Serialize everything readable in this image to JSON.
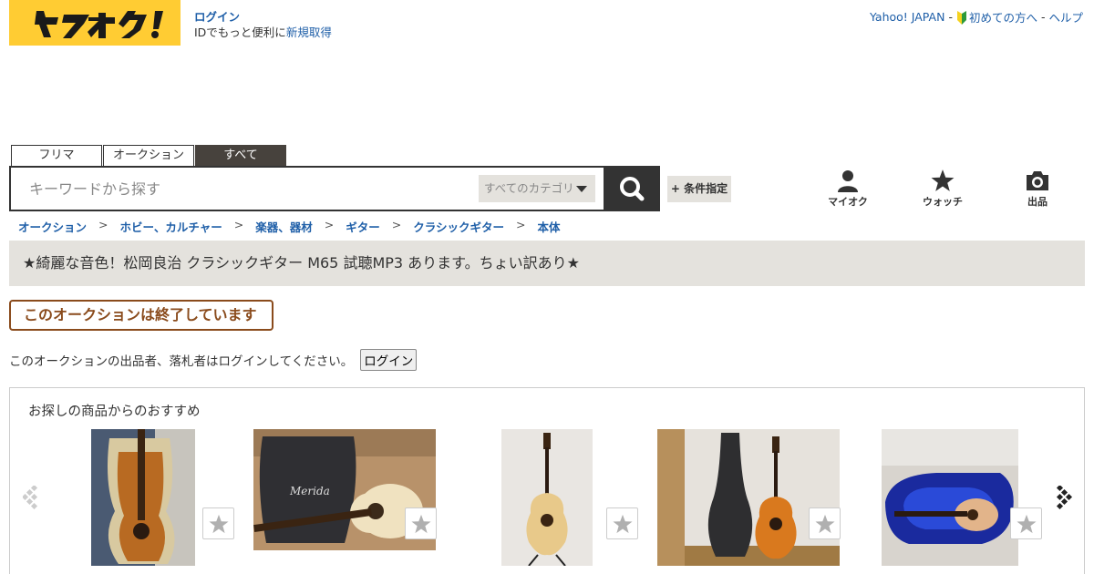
{
  "header": {
    "logo_text": "ヤフオク!",
    "login_link": "ログイン",
    "login_sub_text": "IDでもっと便利に",
    "register_link": "新規取得",
    "yahoo_japan_link": "Yahoo! JAPAN",
    "beginner_link": "初めての方へ",
    "help_link": "ヘルプ",
    "separator": "-"
  },
  "search": {
    "tabs": [
      {
        "label": "フリマ",
        "active": false
      },
      {
        "label": "オークション",
        "active": false
      },
      {
        "label": "すべて",
        "active": true
      }
    ],
    "placeholder": "キーワードから探す",
    "category_selected": "すべてのカテゴリ",
    "condition_button": "+ 条件指定"
  },
  "nav": {
    "my_auction": "マイオク",
    "watch": "ウォッチ",
    "sell": "出品"
  },
  "breadcrumb": {
    "separator": ">",
    "items": [
      "オークション",
      "ホビー、カルチャー",
      "楽器、器材",
      "ギター",
      "クラシックギター",
      "本体"
    ]
  },
  "item": {
    "title": "★綺麗な音色！松岡良治 クラシックギター M65 試聴MP3 あります。ちょい訳あり★",
    "ended_badge": "このオークションは終了しています",
    "login_note": "このオークションの出品者、落札者はログインしてください。",
    "login_button": "ログイン"
  },
  "recommendations": {
    "title": "お探しの商品からのおすすめ",
    "items": [
      {
        "image": "guitar-in-open-case"
      },
      {
        "image": "guitar-with-gig-bag"
      },
      {
        "image": "guitar-on-stand"
      },
      {
        "image": "guitar-with-hard-case"
      },
      {
        "image": "guitar-in-blue-case"
      }
    ]
  },
  "colors": {
    "logo_bg": "#ffcc33",
    "link": "#1f5fa8",
    "title_bar_bg": "#e4e2dd",
    "active_tab_bg": "#47423d",
    "ended_badge": "#8a4b1c"
  }
}
